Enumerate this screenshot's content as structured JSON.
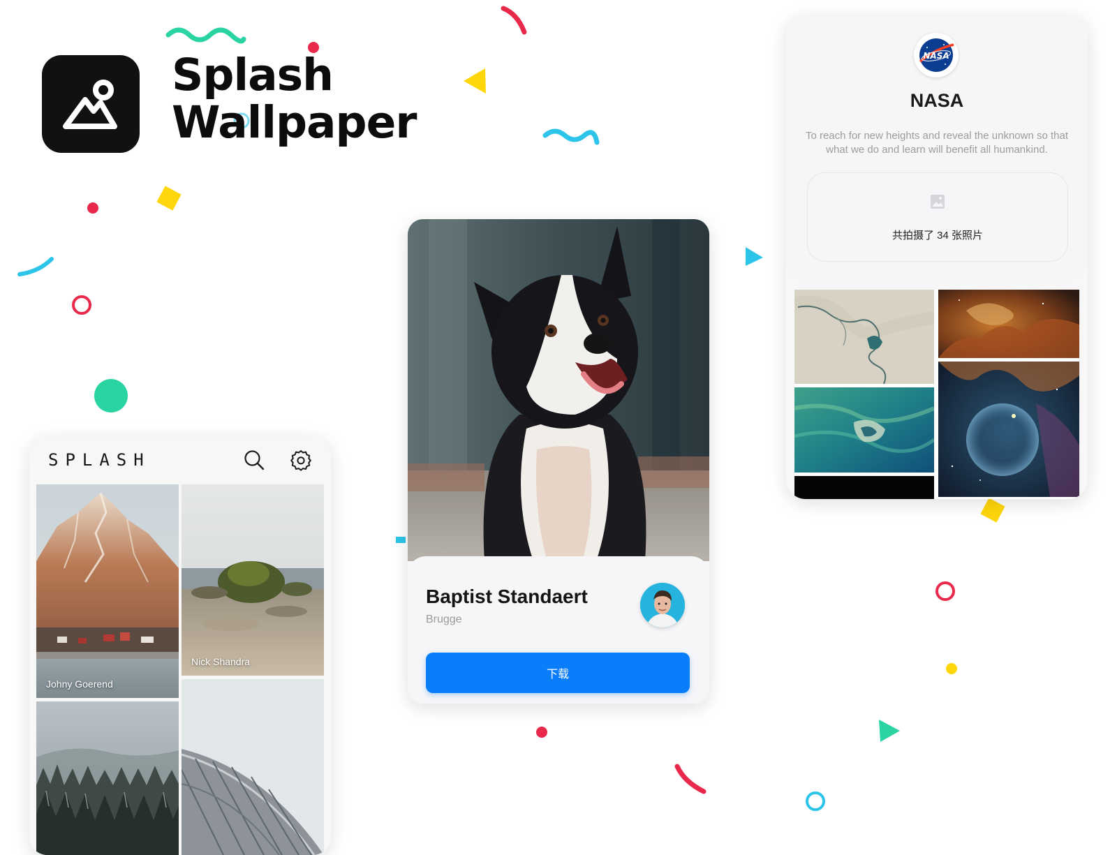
{
  "app": {
    "title_line1": "Splash",
    "title_line2": "Wallpaper",
    "icon": "mountain-image-icon"
  },
  "list_screen": {
    "brand": "SPLASH",
    "header_icons": [
      "search-icon",
      "gear-icon"
    ],
    "photos": [
      {
        "author": "Johny Goerend",
        "subject": "snowy mountain village"
      },
      {
        "author": "Nick Shandra",
        "subject": "mossy rock on beach"
      },
      {
        "author": "",
        "subject": "misty pine forest"
      },
      {
        "author": "",
        "subject": "curved building roof"
      }
    ]
  },
  "photo_screen": {
    "subject": "border collie dog",
    "name": "Baptist Standaert",
    "location": "Brugge",
    "download_label": "下载"
  },
  "profile_screen": {
    "logo_text": "NASA",
    "name": "NASA",
    "bio": "To reach for new heights and reveal the unknown so that what we do and learn will benefit all humankind.",
    "photo_count_label": "共拍摄了 34 张照片",
    "stats_icon": "image-icon",
    "photos": [
      "desert river aerial",
      "orange nebula",
      "green ocean aerial",
      "bubble nebula",
      "black photo"
    ]
  },
  "colors": {
    "accent": "#0a7dfa",
    "confetti_red": "#e8294c",
    "confetti_teal": "#2ad4a2",
    "confetti_yellow": "#ffd60a",
    "confetti_blue": "#2cc4e8"
  }
}
